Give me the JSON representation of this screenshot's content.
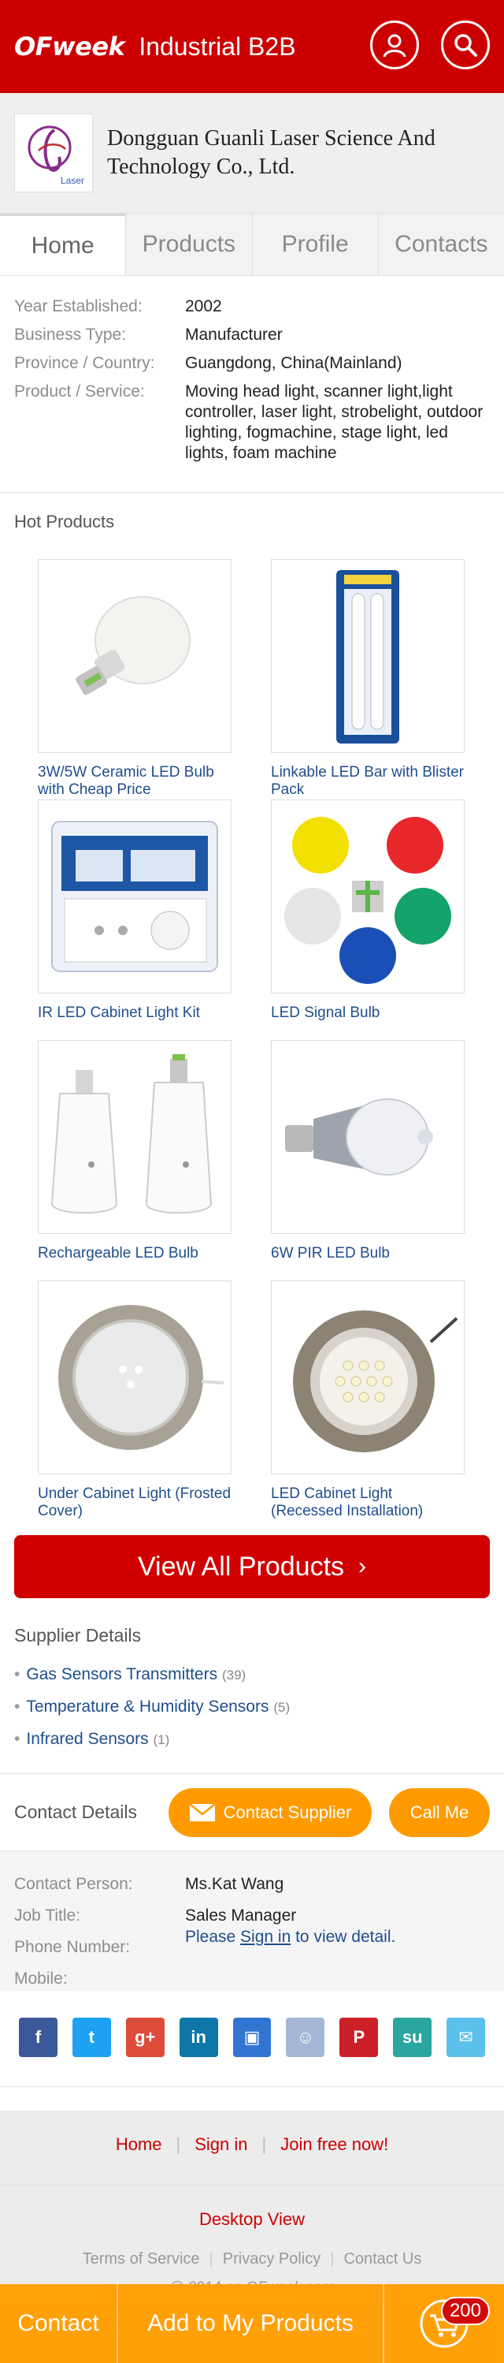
{
  "header": {
    "brand": "OFweek",
    "section": "Industrial B2B",
    "icons": [
      "user-icon",
      "search-icon"
    ]
  },
  "company": {
    "name": "Dongguan Guanli Laser Science And Technology Co., Ltd.",
    "logo_text": "Laser"
  },
  "tabs": [
    {
      "label": "Home",
      "active": true
    },
    {
      "label": "Products",
      "active": false
    },
    {
      "label": "Profile",
      "active": false
    },
    {
      "label": "Contacts",
      "active": false
    }
  ],
  "info": [
    {
      "key": "Year Established:",
      "value": "2002"
    },
    {
      "key": "Business Type:",
      "value": "Manufacturer"
    },
    {
      "key": "Province / Country:",
      "value": "Guangdong, China(Mainland)"
    },
    {
      "key": "Product / Service:",
      "value": "Moving head light, scanner light,light controller, laser light, strobelight, outdoor lighting, fogmachine, stage light, led lights, foam machine"
    }
  ],
  "hot_products": {
    "title": "Hot Products",
    "items": [
      {
        "name": "3W/5W Ceramic LED Bulb with Cheap Price",
        "icon": "bulb-icon"
      },
      {
        "name": "Linkable LED Bar with Blister Pack",
        "icon": "led-bar-icon"
      },
      {
        "name": "IR LED Cabinet Light Kit",
        "icon": "cabinet-kit-icon"
      },
      {
        "name": "LED Signal Bulb",
        "icon": "signal-bulbs-icon"
      },
      {
        "name": "Rechargeable LED Bulb",
        "icon": "rechargeable-bulb-icon"
      },
      {
        "name": "6W PIR LED Bulb",
        "icon": "pir-bulb-icon"
      },
      {
        "name": "Under Cabinet Light (Frosted Cover)",
        "icon": "round-light-icon"
      },
      {
        "name": "LED Cabinet Light (Recessed Installation)",
        "icon": "recessed-light-icon"
      }
    ],
    "view_all": "View All Products"
  },
  "supplier": {
    "title": "Supplier Details",
    "items": [
      {
        "label": "Gas Sensors Transmitters",
        "count": "(39)"
      },
      {
        "label": "Temperature & Humidity Sensors",
        "count": "(5)"
      },
      {
        "label": "Infrared Sensors",
        "count": "(1)"
      }
    ]
  },
  "contact": {
    "title": "Contact Details",
    "contact_supplier": "Contact Supplier",
    "call_me": "Call Me",
    "rows": [
      {
        "key": "Contact Person:",
        "value": "Ms.Kat Wang"
      },
      {
        "key": "Job Title:",
        "value": "Sales Manager"
      },
      {
        "key": "Phone Number:",
        "value": ""
      },
      {
        "key": "Mobile:",
        "value": ""
      }
    ],
    "login_prefix": "Please ",
    "login_link": "Sign in",
    "login_suffix": " to view detail."
  },
  "share": [
    {
      "icon": "facebook-icon",
      "glyph": "f",
      "color": "#3b5998"
    },
    {
      "icon": "twitter-icon",
      "glyph": "t",
      "color": "#1da1f2"
    },
    {
      "icon": "google-plus-icon",
      "glyph": "g+",
      "color": "#dd4b39"
    },
    {
      "icon": "linkedin-icon",
      "glyph": "in",
      "color": "#0e76a8"
    },
    {
      "icon": "delicious-icon",
      "glyph": "▣",
      "color": "#3274d1"
    },
    {
      "icon": "reddit-icon",
      "glyph": "☺",
      "color": "#a4b7d6"
    },
    {
      "icon": "pinterest-icon",
      "glyph": "P",
      "color": "#cb2027"
    },
    {
      "icon": "stumbleupon-icon",
      "glyph": "su",
      "color": "#2aa5a0"
    },
    {
      "icon": "email-icon",
      "glyph": "✉",
      "color": "#5bc0eb"
    }
  ],
  "footer": {
    "links": [
      "Home",
      "Sign in",
      "Join free now!"
    ],
    "desktop": "Desktop View",
    "legal": [
      "Terms of Service",
      "Privacy Policy",
      "Contact Us"
    ],
    "copyright": "@ 2014 en.OFweek.com"
  },
  "bottom_bar": {
    "contact": "Contact",
    "add": "Add to My Products",
    "cart_count": "200"
  }
}
